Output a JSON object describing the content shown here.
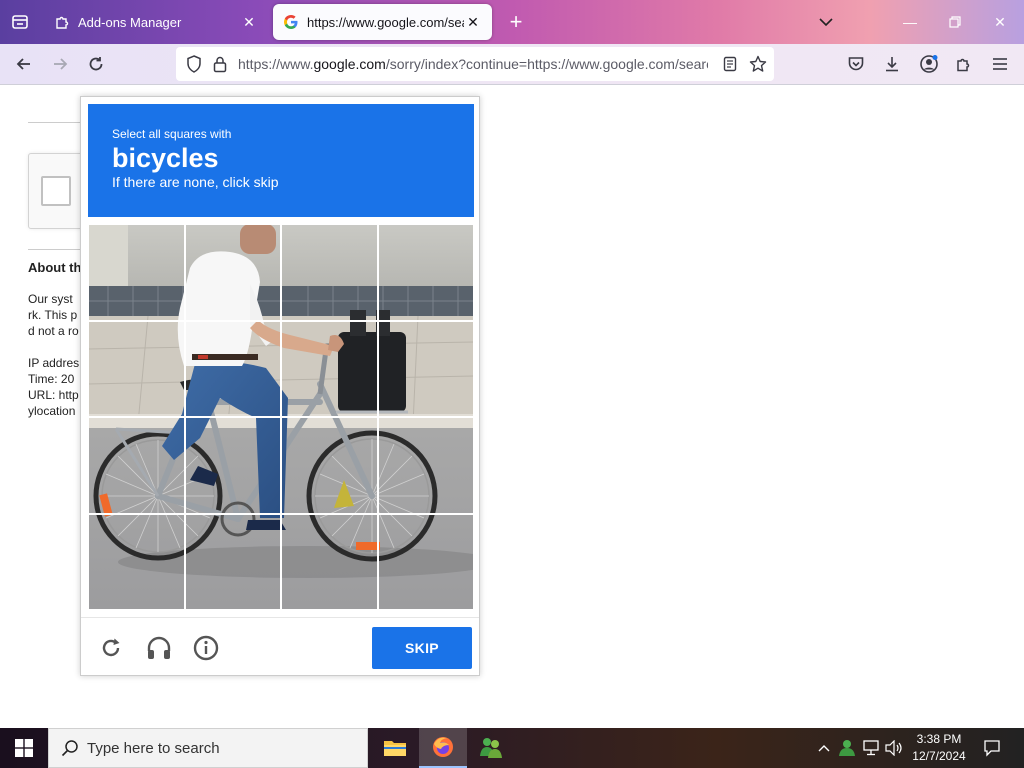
{
  "browser": {
    "tabs": [
      {
        "title": "Add-ons Manager",
        "active": false
      },
      {
        "title": "https://www.google.com/search",
        "active": true
      }
    ],
    "url_domain_prefix": "https://www.",
    "url_domain": "google.com",
    "url_rest": "/sorry/index?continue=https://www.google.com/search",
    "accent_color": "#1a73e8"
  },
  "page_background": {
    "heading": "About th",
    "lines": [
      "Our syst",
      "rk. This p",
      "d not a ro",
      "IP addres",
      "Time: 20",
      "URL: http",
      "ylocation"
    ]
  },
  "captcha": {
    "instruction_top": "Select all squares with",
    "target": "bicycles",
    "instruction_bottom": "If there are none, click skip",
    "skip_label": "SKIP",
    "grid_rows": 4,
    "grid_cols": 4,
    "icons": [
      "reload-icon",
      "audio-icon",
      "info-icon"
    ]
  },
  "taskbar": {
    "search_placeholder": "Type here to search",
    "time": "3:38 PM",
    "date": "12/7/2024",
    "apps": [
      "file-explorer-icon",
      "firefox-icon",
      "messenger-icon"
    ]
  }
}
